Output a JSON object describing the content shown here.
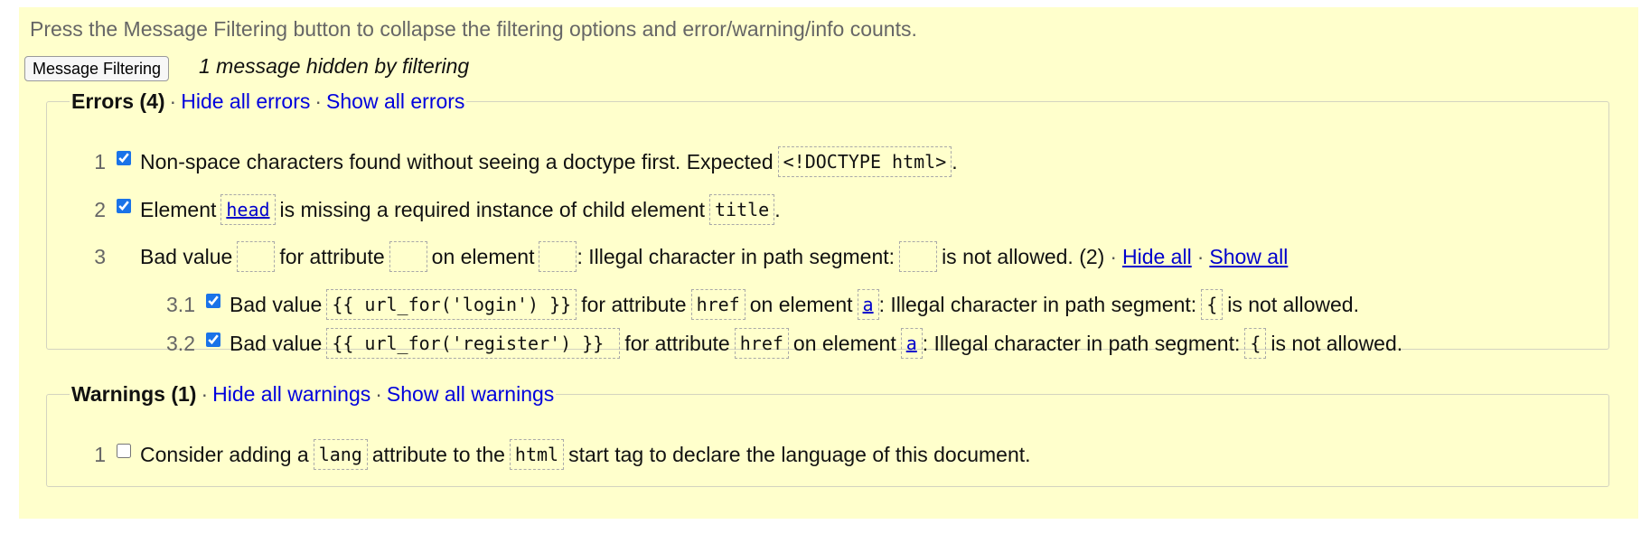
{
  "instruction": "Press the Message Filtering button to collapse the filtering options and error/warning/info counts.",
  "filter_button": "Message Filtering",
  "hidden_note": "1 message hidden by filtering",
  "errors": {
    "title": "Errors (4)",
    "hide_all": "Hide all errors",
    "show_all": "Show all errors",
    "items": [
      {
        "num": "1",
        "checked": true,
        "t1": "Non-space characters found without seeing a doctype first. Expected",
        "code1": "<!DOCTYPE html>",
        "t2": "."
      },
      {
        "num": "2",
        "checked": true,
        "t1": "Element",
        "code1": "head",
        "t2": "is missing a required instance of child element",
        "code2": "title",
        "t3": "."
      },
      {
        "num": "3",
        "t1": "Bad value",
        "t2": "for attribute",
        "t3": "on element",
        "t4": ": Illegal character in path segment:",
        "t5": "is not allowed. (2)",
        "hide_all": "Hide all",
        "show_all": "Show all",
        "sub": [
          {
            "num": "3.1",
            "checked": true,
            "t1": "Bad value",
            "value": "{{ url_for('login') }}",
            "t2": "for attribute",
            "attr": "href",
            "t3": "on element",
            "elem": "a",
            "t4": ": Illegal character in path segment:",
            "char": "{",
            "t5": "is not allowed."
          },
          {
            "num": "3.2",
            "checked": true,
            "t1": "Bad value",
            "value": "{{ url_for('register') }} ",
            "t2": "for attribute",
            "attr": "href",
            "t3": "on element",
            "elem": "a",
            "t4": ": Illegal character in path segment:",
            "char": "{",
            "t5": "is not allowed."
          }
        ]
      }
    ]
  },
  "warnings": {
    "title": "Warnings (1)",
    "hide_all": "Hide all warnings",
    "show_all": "Show all warnings",
    "items": [
      {
        "num": "1",
        "checked": false,
        "t1": "Consider adding a",
        "code1": "lang",
        "t2": "attribute to the",
        "code2": "html",
        "t3": "start tag to declare the language of this document."
      }
    ]
  },
  "separator": "·"
}
